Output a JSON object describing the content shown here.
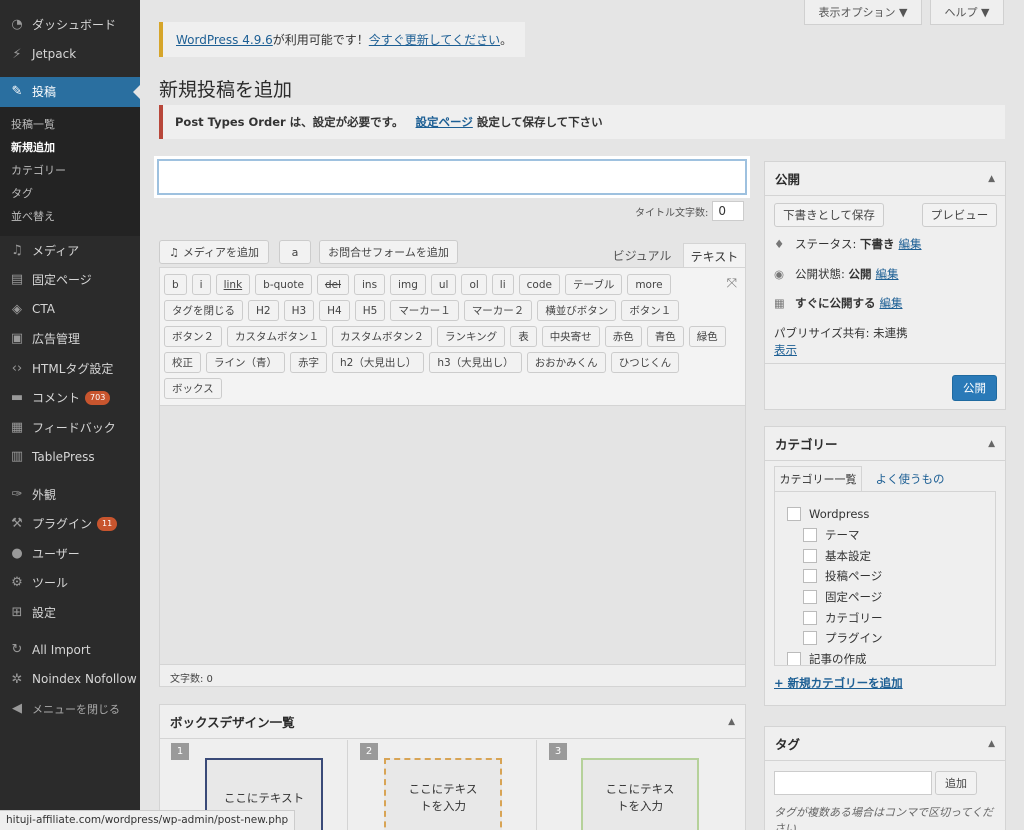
{
  "sidebar": {
    "items": [
      {
        "icon": "dashboard-icon",
        "label": "ダッシュボード"
      },
      {
        "icon": "jetpack-icon",
        "label": "Jetpack"
      },
      {
        "icon": "posts-icon",
        "label": "投稿"
      },
      {
        "icon": "media-icon",
        "label": "メディア"
      },
      {
        "icon": "page-icon",
        "label": "固定ページ"
      },
      {
        "icon": "tag-icon",
        "label": "CTA"
      },
      {
        "icon": "ad-icon",
        "label": "広告管理"
      },
      {
        "icon": "code-icon",
        "label": "HTMLタグ設定"
      },
      {
        "icon": "comment-icon",
        "label": "コメント",
        "badge": "703"
      },
      {
        "icon": "feedback-icon",
        "label": "フィードバック"
      },
      {
        "icon": "table-icon",
        "label": "TablePress"
      },
      {
        "icon": "appearance-icon",
        "label": "外観"
      },
      {
        "icon": "plugin-icon",
        "label": "プラグイン",
        "badge": "11"
      },
      {
        "icon": "user-icon",
        "label": "ユーザー"
      },
      {
        "icon": "tools-icon",
        "label": "ツール"
      },
      {
        "icon": "settings-icon",
        "label": "設定"
      },
      {
        "icon": "import-icon",
        "label": "All Import"
      },
      {
        "icon": "gear-icon",
        "label": "Noindex Nofollow"
      },
      {
        "icon": "collapse-icon",
        "label": "メニューを閉じる"
      }
    ],
    "submenu": [
      "投稿一覧",
      "新規追加",
      "カテゴリー",
      "タグ",
      "並べ替え"
    ]
  },
  "top": {
    "screen_options": "表示オプション ▼",
    "help": "ヘルプ ▼"
  },
  "update_notice": {
    "link": "WordPress 4.9.6",
    "text": " が利用可能です！",
    "link2": "今すぐ更新してください",
    "end": "。"
  },
  "page_title": "新規投稿を追加",
  "pto_notice": {
    "text": "Post Types Order は、設定が必要です。",
    "link": "設定ページ",
    "text2": "設定して保存して下さい"
  },
  "title_field": {
    "value": "",
    "count_label": "タイトル文字数:",
    "count": "0"
  },
  "editor": {
    "add_media": "メディアを追加",
    "contact_form": "お問合せフォームを追加",
    "tab_visual": "ビジュアル",
    "tab_text": "テキスト",
    "quicktags": [
      "b",
      "i",
      "link",
      "b-quote",
      "del",
      "ins",
      "img",
      "ul",
      "ol",
      "li",
      "code",
      "テーブル",
      "more",
      "タグを閉じる",
      "H2",
      "H3",
      "H4",
      "H5",
      "マーカー１",
      "マーカー２",
      "横並びボタン",
      "ボタン１",
      "ボタン２",
      "カスタムボタン１",
      "カスタムボタン２",
      "ランキング",
      "表",
      "中央寄せ",
      "赤色",
      "青色",
      "緑色",
      "校正",
      "ライン（青）",
      "赤字",
      "h2（大見出し）",
      "h3（大見出し）",
      "おおかみくん",
      "ひつじくん",
      "ボックス"
    ],
    "word_count": "文字数: 0"
  },
  "box_design": {
    "title": "ボックスデザイン一覧",
    "cards": [
      {
        "num": "1",
        "text": "ここにテキスト"
      },
      {
        "num": "2",
        "text": "ここにテキストを入力"
      },
      {
        "num": "3",
        "text": "ここにテキストを入力"
      }
    ]
  },
  "publish": {
    "title": "公開",
    "save_draft": "下書きとして保存",
    "preview": "プレビュー",
    "status_label": "ステータス:",
    "status": "下書き",
    "visibility_label": "公開状態:",
    "visibility": "公開",
    "schedule": "すぐに公開する",
    "edit": "編集",
    "publicize": "パブリサイズ共有: 未連携",
    "show": "表示",
    "publish_btn": "公開"
  },
  "categories": {
    "title": "カテゴリー",
    "tab_all": "カテゴリー一覧",
    "tab_popular": "よく使うもの",
    "items": [
      {
        "label": "Wordpress",
        "child": false
      },
      {
        "label": "テーマ",
        "child": true
      },
      {
        "label": "基本設定",
        "child": true
      },
      {
        "label": "投稿ページ",
        "child": true
      },
      {
        "label": "固定ページ",
        "child": true
      },
      {
        "label": "カテゴリー",
        "child": true
      },
      {
        "label": "プラグイン",
        "child": true
      },
      {
        "label": "記事の作成",
        "child": false
      }
    ],
    "add_new": "+ 新規カテゴリーを追加"
  },
  "tags": {
    "title": "タグ",
    "add": "追加",
    "hint": "タグが複数ある場合はコンマで区切ってください"
  },
  "statusbar": "hituji-affiliate.com/wordpress/wp-admin/post-new.php"
}
